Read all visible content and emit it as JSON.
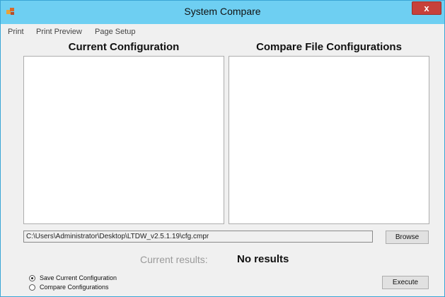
{
  "window": {
    "title": "System Compare",
    "close_label": "x",
    "accent_color": "#6ecff2",
    "close_color": "#c7413a"
  },
  "menu": {
    "items": [
      "Print",
      "Print Preview",
      "Page Setup"
    ]
  },
  "panels": {
    "current_title": "Current Configuration",
    "compare_title": "Compare File Configurations"
  },
  "file": {
    "path": "C:\\Users\\Administrator\\Desktop\\LTDW_v2.5.1.19\\cfg.cmpr",
    "browse_label": "Browse"
  },
  "results": {
    "label": "Current results:",
    "value": "No results"
  },
  "mode": {
    "options": [
      "Save Current Configuration",
      "Compare Configurations"
    ],
    "selected": "Save Current Configuration"
  },
  "execute_label": "Execute",
  "icons": {
    "app": "app-icon",
    "close": "close-icon"
  }
}
